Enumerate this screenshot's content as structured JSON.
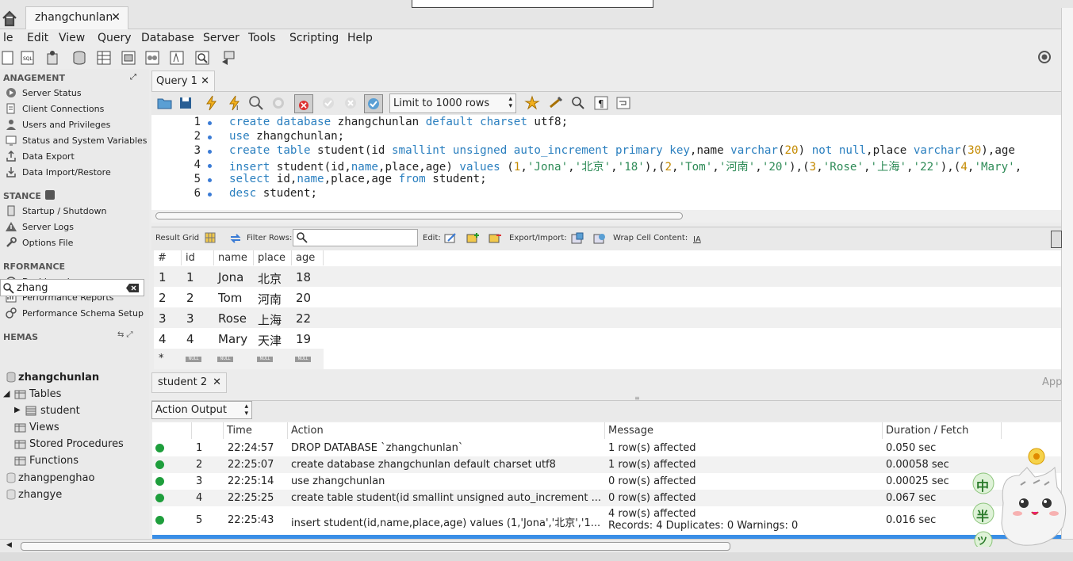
{
  "connection_tab": {
    "title": "zhangchunlan",
    "close": "✕"
  },
  "menu": {
    "file": "le",
    "edit": "Edit",
    "view": "View",
    "query": "Query",
    "database": "Database",
    "server": "Server",
    "tools": "Tools",
    "scripting": "Scripting",
    "help": "Help"
  },
  "sidebar": {
    "management_header": "ANAGEMENT",
    "management": [
      "Server Status",
      "Client Connections",
      "Users and Privileges",
      "Status and System Variables",
      "Data Export",
      "Data Import/Restore"
    ],
    "instance_header": "STANCE",
    "instance": [
      "Startup / Shutdown",
      "Server Logs",
      "Options File"
    ],
    "performance_header": "RFORMANCE",
    "performance": [
      "Dashboard",
      "Performance Reports",
      "Performance Schema Setup"
    ],
    "schemas_header": "HEMAS",
    "search_value": "zhang",
    "tree": {
      "schema": "zhangchunlan",
      "tables": "Tables",
      "student": "student",
      "views": "Views",
      "procs": "Stored Procedures",
      "funcs": "Functions",
      "other1": "zhangpenghao",
      "other2": "zhangye"
    }
  },
  "query_tab": {
    "title": "Query 1",
    "close": "✕"
  },
  "sql_toolbar": {
    "limit": "Limit to 1000 rows"
  },
  "editor": {
    "line_numbers": [
      "1",
      "2",
      "3",
      "4",
      "5",
      "6"
    ]
  },
  "result_toolbar": {
    "result_grid": "Result Grid",
    "filter_rows": "Filter Rows:",
    "edit": "Edit:",
    "export_import": "Export/Import:",
    "wrap": "Wrap Cell Content:"
  },
  "grid": {
    "columns": [
      "#",
      "id",
      "name",
      "place",
      "age"
    ],
    "rows": [
      [
        "1",
        "1",
        "Jona",
        "北京",
        "18"
      ],
      [
        "2",
        "2",
        "Tom",
        "河南",
        "20"
      ],
      [
        "3",
        "3",
        "Rose",
        "上海",
        "22"
      ],
      [
        "4",
        "4",
        "Mary",
        "天津",
        "19"
      ]
    ],
    "new_row_marker": "*",
    "null_label": "NULL"
  },
  "result_tab": {
    "title": "student 2",
    "close": "✕"
  },
  "app_trunc": "App",
  "output": {
    "selector": "Action Output",
    "columns": [
      "",
      "",
      "Time",
      "Action",
      "Message",
      "Duration / Fetch"
    ],
    "rows": [
      {
        "n": "1",
        "time": "22:24:57",
        "action": "DROP DATABASE `zhangchunlan`",
        "message": "1 row(s) affected",
        "message2": "",
        "duration": "0.050 sec"
      },
      {
        "n": "2",
        "time": "22:25:07",
        "action": "create database zhangchunlan default charset utf8",
        "message": "1 row(s) affected",
        "message2": "",
        "duration": "0.00058 sec"
      },
      {
        "n": "3",
        "time": "22:25:14",
        "action": "use zhangchunlan",
        "message": "0 row(s) affected",
        "message2": "",
        "duration": "0.00025 sec"
      },
      {
        "n": "4",
        "time": "22:25:25",
        "action": "create table student(id smallint unsigned auto_increment ...",
        "message": "0 row(s) affected",
        "message2": "",
        "duration": "0.067 sec"
      },
      {
        "n": "5",
        "time": "22:25:43",
        "action": "insert student(id,name,place,age) values (1,'Jona','北京','1...",
        "message": "4 row(s) affected",
        "message2": "Records: 4  Duplicates: 0  Warnings: 0",
        "duration": "0.016 sec"
      }
    ]
  },
  "mascot": {
    "chars": [
      "中",
      "半",
      "ツ"
    ]
  },
  "colors": {
    "keyword": "#2a7fbf",
    "number": "#c48a00",
    "string": "#2e8b57",
    "ok": "#1e9e3c",
    "selection": "#3a8ee6"
  }
}
